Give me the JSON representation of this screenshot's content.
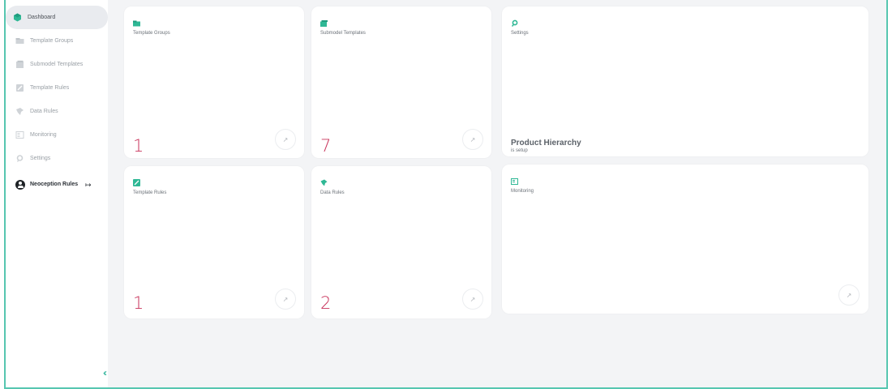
{
  "sidebar": {
    "items": [
      {
        "label": "Dashboard",
        "icon": "dashboard-icon",
        "active": true
      },
      {
        "label": "Template Groups",
        "icon": "template-groups-icon",
        "active": false
      },
      {
        "label": "Submodel Templates",
        "icon": "submodel-templates-icon",
        "active": false
      },
      {
        "label": "Template Rules",
        "icon": "template-rules-icon",
        "active": false
      },
      {
        "label": "Data Rules",
        "icon": "data-rules-icon",
        "active": false
      },
      {
        "label": "Monitoring",
        "icon": "monitoring-icon",
        "active": false
      },
      {
        "label": "Settings",
        "icon": "settings-icon",
        "active": false
      }
    ],
    "user": {
      "name": "Neoception Rules",
      "logout_icon": "logout-icon"
    },
    "collapse_icon": "double-chevron-left-icon"
  },
  "cards": {
    "template_groups": {
      "title": "Template Groups",
      "count": "1"
    },
    "submodel_templates": {
      "title": "Submodel Templates",
      "count": "7"
    },
    "settings": {
      "title": "Settings",
      "hierarchy_title": "Product Hierarchy",
      "hierarchy_status": "is setup"
    },
    "template_rules": {
      "title": "Template Rules",
      "count": "1"
    },
    "data_rules": {
      "title": "Data Rules",
      "count": "2"
    },
    "monitoring": {
      "title": "Monitoring"
    }
  },
  "arrow_glyph": "↗",
  "colors": {
    "accent": "#3fb9a2",
    "count": "#c8325a",
    "border": "#56c6b0",
    "background": "#f3f4f6"
  }
}
